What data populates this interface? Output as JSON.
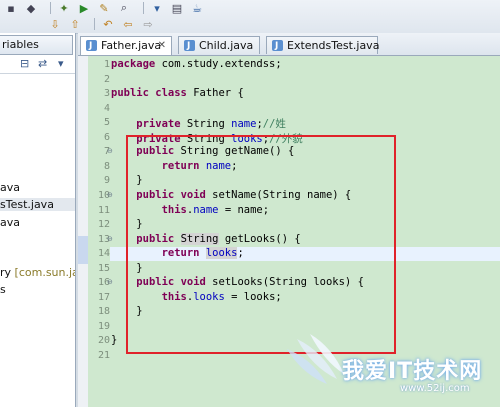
{
  "toolbar": {
    "row1_icons": [
      "save-icon",
      "new-icon",
      "debug-icon",
      "run-icon",
      "open-type-icon",
      "search-icon",
      "external-tools-icon",
      "perspective-icon",
      "java-perspective-icon"
    ],
    "row2_icons": [
      "next-annotation-icon",
      "prev-annotation-icon",
      "last-edit-icon",
      "back-icon",
      "forward-icon"
    ]
  },
  "left_panel": {
    "tab_label": "riables",
    "tree": [
      {
        "label": "ava",
        "selected": false
      },
      {
        "label": "sTest.java",
        "selected": true
      },
      {
        "label": "ava",
        "selected": false
      },
      {
        "label": "ry ",
        "suffix": "[com.sun.ja",
        "selected": false
      },
      {
        "label": "s",
        "selected": false
      }
    ]
  },
  "editor": {
    "tabs": [
      {
        "label": "Father.java",
        "active": true,
        "closable": true
      },
      {
        "label": "Child.java",
        "active": false
      },
      {
        "label": "ExtendsTest.java",
        "active": false
      }
    ],
    "line_numbers": [
      "1",
      "2",
      "3",
      "4",
      "5",
      "6",
      "7",
      "8",
      "9",
      "10",
      "11",
      "12",
      "13",
      "14",
      "15",
      "16",
      "17",
      "18",
      "19",
      "20",
      "21"
    ],
    "lines": [
      "package com.study.extendss;",
      "",
      "public class Father {",
      "",
      "    private String name;//姓",
      "    private String looks;//外貌",
      "    public String getName() {",
      "        return name;",
      "    }",
      "    public void setName(String name) {",
      "        this.name = name;",
      "    }",
      "    public String getLooks() {",
      "        return looks;",
      "    }",
      "    public void setLooks(String looks) {",
      "        this.looks = looks;",
      "    }",
      "",
      "}",
      ""
    ],
    "highlighted_line": 14
  },
  "watermark": {
    "text": "我爱IT技术网",
    "url": "www.52ij.com"
  },
  "colors": {
    "code_bg": "#cfe8cf",
    "highlight_box": "#e0222a",
    "keyword": "#7f0055",
    "field": "#0000c0"
  }
}
